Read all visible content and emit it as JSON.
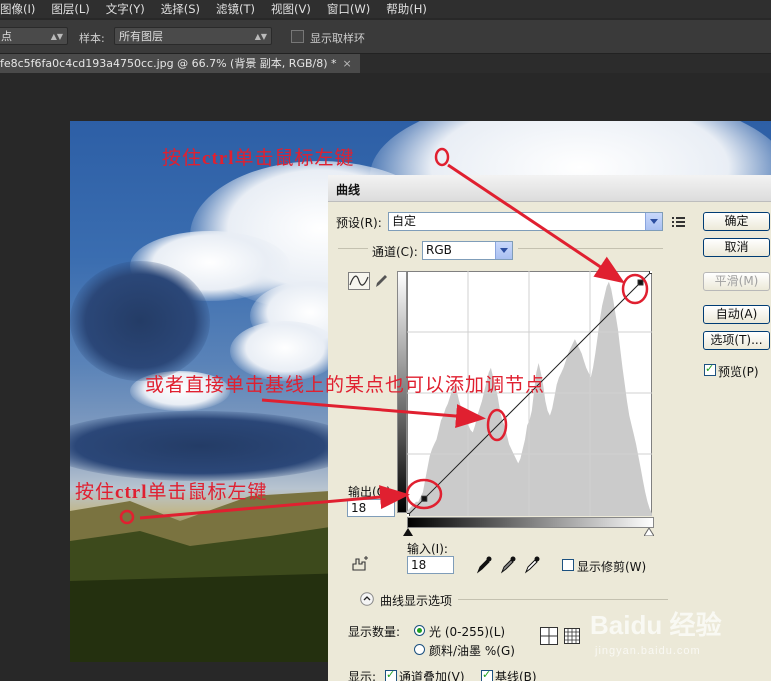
{
  "menu": [
    "图像(I)",
    "图层(L)",
    "文字(Y)",
    "选择(S)",
    "滤镜(T)",
    "视图(V)",
    "窗口(W)",
    "帮助(H)"
  ],
  "options_bar": {
    "tool_value": "点",
    "sample_label": "样本:",
    "sample_value": "所有图层",
    "show_ring_label": "显示取样环"
  },
  "document_tab": {
    "title": "fe8c5f6fa0c4cd193a4750cc.jpg @ 66.7% (背景 副本, RGB/8) *",
    "close": "×"
  },
  "dialog": {
    "title": "曲线",
    "preset_label": "预设(R):",
    "preset_value": "自定",
    "channel_label": "通道(C):",
    "channel_value": "RGB",
    "output_label": "输出(O):",
    "output_value": "18",
    "input_label": "输入(I):",
    "input_value": "18",
    "show_clipping_label": "显示修剪(W)",
    "buttons": {
      "ok": "确定",
      "cancel": "取消",
      "smooth": "平滑(M)",
      "auto": "自动(A)",
      "options": "选项(T)..."
    },
    "preview_label": "预览(P)",
    "curve_display_options": "曲线显示选项",
    "show_amount_label": "显示数量:",
    "light_option": "光 (0-255)(L)",
    "pigment_option": "颜料/油墨 %(G)",
    "show_label": "显示:",
    "channel_overlay_label": "通道叠加(V)",
    "baseline_label": "基线(B)",
    "curve_points": [
      [
        18,
        18
      ],
      [
        243,
        243
      ]
    ],
    "histogram": [
      0.02,
      0.03,
      0.04,
      0.05,
      0.06,
      0.06,
      0.08,
      0.1,
      0.15,
      0.2,
      0.25,
      0.28,
      0.3,
      0.32,
      0.36,
      0.4,
      0.42,
      0.45,
      0.47,
      0.5,
      0.53,
      0.55,
      0.52,
      0.48,
      0.45,
      0.43,
      0.4,
      0.38,
      0.36,
      0.35,
      0.38,
      0.42,
      0.45,
      0.48,
      0.52,
      0.56,
      0.6,
      0.62,
      0.58,
      0.54,
      0.5,
      0.44,
      0.4,
      0.38,
      0.34,
      0.3,
      0.28,
      0.26,
      0.24,
      0.22,
      0.24,
      0.28,
      0.32,
      0.38,
      0.4,
      0.44,
      0.52,
      0.6,
      0.64,
      0.6,
      0.55,
      0.48,
      0.44,
      0.42,
      0.45,
      0.5,
      0.55,
      0.58,
      0.6,
      0.62,
      0.65,
      0.68,
      0.7,
      0.72,
      0.74,
      0.72,
      0.7,
      0.68,
      0.65,
      0.62,
      0.6,
      0.58,
      0.62,
      0.68,
      0.75,
      0.82,
      0.88,
      0.92,
      0.96,
      0.98,
      0.95,
      0.9,
      0.84,
      0.78,
      0.7,
      0.62,
      0.55,
      0.48,
      0.42,
      0.38,
      0.34,
      0.3,
      0.25,
      0.2,
      0.15,
      0.1,
      0.06,
      0.03,
      0.01
    ]
  },
  "annotations": {
    "top": {
      "pre": "按住",
      "key": "ctrl",
      "post": "单击鼠标左键"
    },
    "middle": "或者直接单击基线上的某点也可以添加调节点",
    "bottom": {
      "pre": "按住",
      "key": "ctrl",
      "post": "单击鼠标左键"
    }
  },
  "colors": {
    "annotation": "#e02030",
    "dialog_bg": "#ece9d8",
    "ps_bg": "#282828"
  },
  "watermark": {
    "brand": "Baidu 经验",
    "url": "jingyan.baidu.com"
  }
}
